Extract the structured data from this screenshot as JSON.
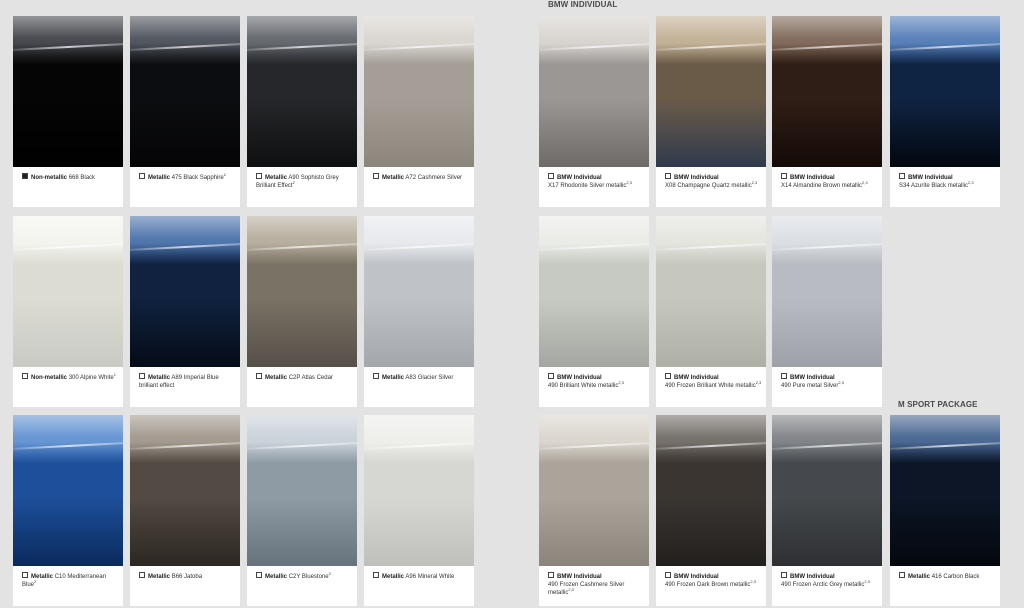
{
  "sections": {
    "individual": "BMW INDIVIDUAL",
    "msport": "M SPORT PACKAGE"
  },
  "colors": [
    {
      "type": "Non-metallic",
      "name": "668 Black",
      "sup": "",
      "selected": true,
      "c1": "#3b3e44",
      "c2": "#050505",
      "c3": "#000000"
    },
    {
      "type": "Metallic",
      "name": "475 Black Sapphire",
      "sup": "2",
      "selected": false,
      "c1": "#474c55",
      "c2": "#0c0d10",
      "c3": "#050506"
    },
    {
      "type": "Metallic",
      "name": "A90 Sophisto Grey Brilliant Effect",
      "sup": "2",
      "selected": false,
      "c1": "#5c6066",
      "c2": "#25272a",
      "c3": "#0e0f10"
    },
    {
      "type": "Metallic",
      "name": "A72 Cashmere Silver",
      "sup": "",
      "selected": false,
      "c1": "#d8d4ce",
      "c2": "#a49e96",
      "c3": "#8b857c"
    },
    {
      "type": "BMW Individual",
      "name": "X17 Rhodonite Silver metallic",
      "sup": "2,3",
      "selected": false,
      "c1": "#d6d2cd",
      "c2": "#9b9794",
      "c3": "#6e6a67"
    },
    {
      "type": "BMW Individual",
      "name": "X08 Champagne Quartz metallic",
      "sup": "2,3",
      "selected": false,
      "c1": "#c0ad91",
      "c2": "#6a5b49",
      "c3": "#2f3a4d"
    },
    {
      "type": "BMW Individual",
      "name": "X14 Almandine Brown metallic",
      "sup": "2,3",
      "selected": false,
      "c1": "#7a6252",
      "c2": "#2f1e16",
      "c3": "#140a07"
    },
    {
      "type": "BMW Individual",
      "name": "S34 Azurite Black metallic",
      "sup": "2,3",
      "selected": false,
      "c1": "#4d78b5",
      "c2": "#0f2443",
      "c3": "#03070f"
    },
    {
      "type": "Non-metallic",
      "name": "300 Alpine White",
      "sup": "1",
      "selected": false,
      "c1": "#f3f3ee",
      "c2": "#dcdcd4",
      "c3": "#c9cac3"
    },
    {
      "type": "Metallic",
      "name": "A89 Imperial Blue brilliant effect",
      "sup": "",
      "selected": false,
      "c1": "#456ea8",
      "c2": "#10223f",
      "c3": "#050b17"
    },
    {
      "type": "Metallic",
      "name": "C2P Atlas Cedar",
      "sup": "",
      "selected": false,
      "c1": "#b3aa99",
      "c2": "#7a7264",
      "c3": "#56504a"
    },
    {
      "type": "Metallic",
      "name": "A83 Glacier Silver",
      "sup": "",
      "selected": false,
      "c1": "#e6e8ec",
      "c2": "#bfc3c8",
      "c3": "#a3a7ac"
    },
    {
      "type": "BMW Individual",
      "name": "490 Brilliant White metallic",
      "sup": "2,3",
      "selected": false,
      "c1": "#e9ebe6",
      "c2": "#c7cac3",
      "c3": "#a4a7a1"
    },
    {
      "type": "BMW Individual",
      "name": "490 Frozen Brilliant White metallic",
      "sup": "2,3",
      "selected": false,
      "c1": "#e3e4dc",
      "c2": "#c6c7bd",
      "c3": "#aeafa5"
    },
    {
      "type": "BMW Individual",
      "name": "490 Pure metal Silver",
      "sup": "2,3",
      "selected": false,
      "c1": "#d9dde2",
      "c2": "#b8bcc2",
      "c3": "#9ea2a8"
    },
    {
      "type": "Metallic",
      "name": "C10 Mediterranean Blue",
      "sup": "2",
      "selected": false,
      "c1": "#5d8fd0",
      "c2": "#1d4f9a",
      "c3": "#0b2a5c"
    },
    {
      "type": "Metallic",
      "name": "B66 Jatoba",
      "sup": "",
      "selected": false,
      "c1": "#9e9488",
      "c2": "#524a43",
      "c3": "#2c2722"
    },
    {
      "type": "Metallic",
      "name": "C2Y Bluestone",
      "sup": "2",
      "selected": false,
      "c1": "#c7d0d8",
      "c2": "#8e9aa4",
      "c3": "#66727c"
    },
    {
      "type": "Metallic",
      "name": "A96 Mineral White",
      "sup": "",
      "selected": false,
      "c1": "#ededea",
      "c2": "#d6d7d3",
      "c3": "#bfc0bc"
    },
    {
      "type": "BMW Individual",
      "name": "490 Frozen Cashmere Silver metallic",
      "sup": "2,3",
      "selected": false,
      "c1": "#d9d3cb",
      "c2": "#aba49b",
      "c3": "#8a847b"
    },
    {
      "type": "BMW Individual",
      "name": "490 Frozen Dark Brown metallic",
      "sup": "2,3",
      "selected": false,
      "c1": "#6e6862",
      "c2": "#3a3531",
      "c3": "#22201e"
    },
    {
      "type": "BMW Individual",
      "name": "490 Frozen Arctic Grey metallic",
      "sup": "2,3",
      "selected": false,
      "c1": "#7a7d82",
      "c2": "#45484c",
      "c3": "#2e3033"
    },
    {
      "type": "Metallic",
      "name": "416 Carbon Black",
      "sup": "",
      "selected": false,
      "c1": "#3f5f8c",
      "c2": "#0c1626",
      "c3": "#04070d"
    }
  ]
}
